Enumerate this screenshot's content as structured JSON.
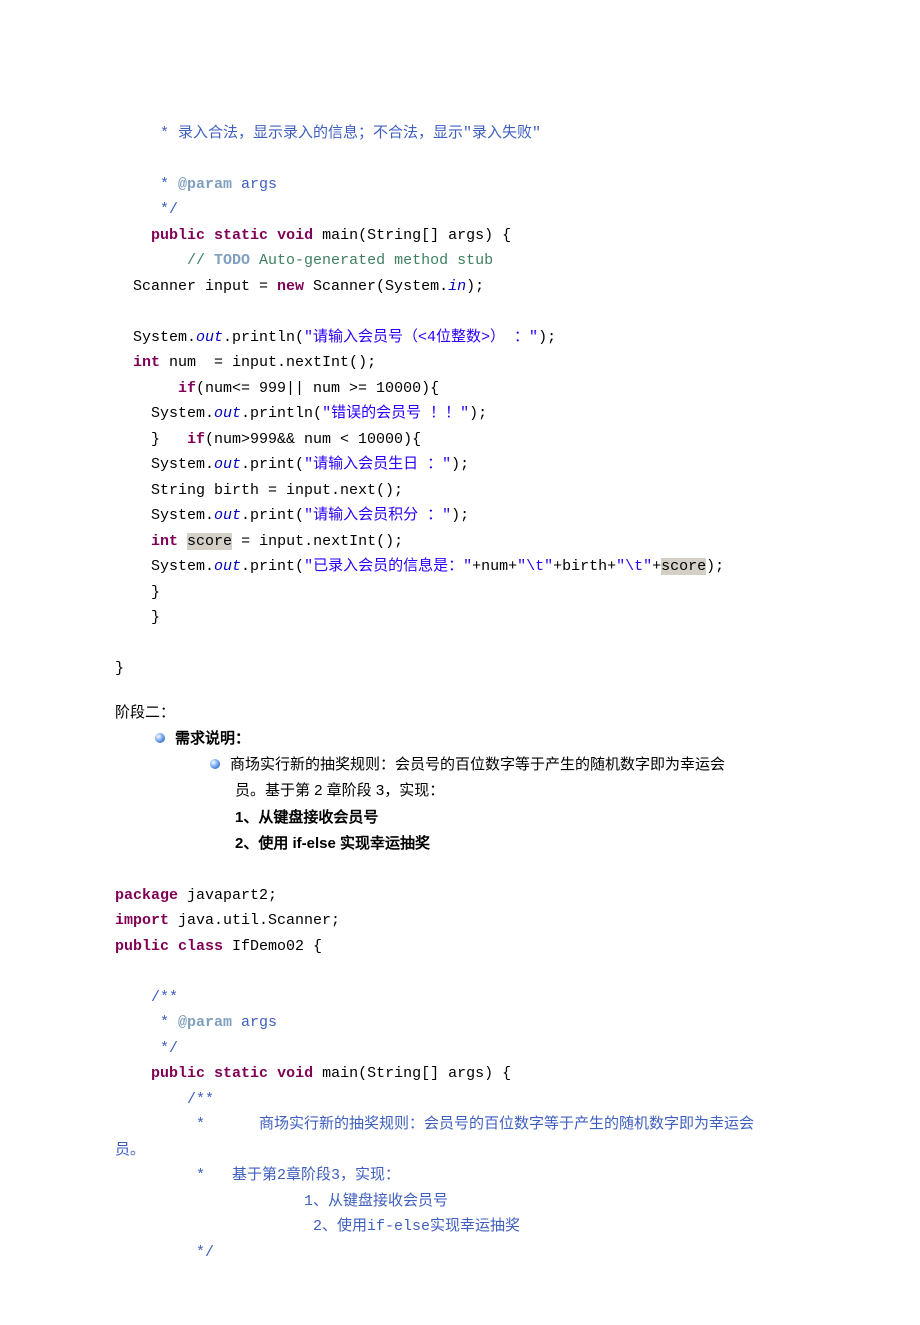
{
  "code1": {
    "c1": "     * 录入合法，显示录入的信息；不合法，显示\"录入失败\"",
    "c2": "     * ",
    "c2_tag": "@param",
    "c2_arg": " args",
    "c3": "     */",
    "m1_kw1": "public",
    "m1_kw2": "static",
    "m1_kw3": "void",
    "m1_a": " main(String[] args) {",
    "m2_c1": "// ",
    "m2_todo": "TODO",
    "m2_c2": " Auto-generated method stub",
    "l_scan1": "  Scanner input = ",
    "l_scan_kw": "new",
    "l_scan2": " Scanner(System.",
    "l_scan_in": "in",
    "l_scan3": ");",
    "l_p1_a": "  System.",
    "l_p1_out": "out",
    "l_p1_b": ".println(",
    "l_p1_s": "\"请输入会员号（<4位整数>） ：\"",
    "l_p1_c": ");",
    "l_int_kw": "int",
    "l_int_rest": " num  = input.nextInt();",
    "l_if1_kw": "if",
    "l_if1_rest": "(num<= 999|| num >= 10000){",
    "l_err_a": "    System.",
    "l_err_out": "out",
    "l_err_b": ".println(",
    "l_err_s": "\"错误的会员号 ！！\"",
    "l_err_c": ");",
    "l_close_if1": "    }   ",
    "l_if2_kw": "if",
    "l_if2_rest": "(num>999&& num < 10000){",
    "l_birth_p_a": "    System.",
    "l_birth_p_out": "out",
    "l_birth_p_b": ".print(",
    "l_birth_p_s": "\"请输入会员生日 ：\"",
    "l_birth_p_c": ");",
    "l_birth_v": "    String birth = input.next();",
    "l_score_p_a": "    System.",
    "l_score_p_out": "out",
    "l_score_p_b": ".print(",
    "l_score_p_s": "\"请输入会员积分 ：\"",
    "l_score_p_c": ");",
    "l_score_kw": "int",
    "l_score_v1": " ",
    "l_score_hl": "score",
    "l_score_v2": " = input.nextInt();",
    "l_final_a": "    System.",
    "l_final_out": "out",
    "l_final_b": ".print(",
    "l_final_s1": "\"已录入会员的信息是：\"",
    "l_final_plus": "+num+",
    "l_final_s2": "\"\\t\"",
    "l_final_plus2": "+birth+",
    "l_final_s3": "\"\\t\"",
    "l_final_plus3": "+",
    "l_final_hl": "score",
    "l_final_c": ");",
    "l_close_braces": "    }\n    }\n\n}"
  },
  "doc": {
    "stage_title": "阶段二：",
    "req_label": "需求说明：",
    "desc_line1": "商场实行新的抽奖规则：会员号的百位数字等于产生的随机数字即为幸运会",
    "desc_line2": "员。基于第 2 章阶段 3，实现：",
    "num1": "1、从键盘接收会员号",
    "num2": "2、使用 if-else 实现幸运抽奖"
  },
  "code2": {
    "pkg_kw": "package",
    "pkg_rest": " javapart2;",
    "imp_kw": "import",
    "imp_rest": " java.util.Scanner;",
    "cls_kw1": "public",
    "cls_kw2": "class",
    "cls_rest": " IfDemo02 {",
    "jd_open": "    /**",
    "jd_star": "     * ",
    "jd_tag": "@param",
    "jd_arg": " args",
    "jd_close": "     */",
    "m_kw1": "public",
    "m_kw2": "static",
    "m_kw3": "void",
    "m_sig": " main(String[] args) {",
    "c_open": "        /**",
    "c_l1": "         *      商场实行新的抽奖规则：会员号的百位数字等于产生的随机数字即为幸运会",
    "c_l1_end": "员。",
    "c_l2": "         *   基于第2章阶段3，实现：",
    "c_l3": "                     1、从键盘接收会员号",
    "c_l4": "                      2、使用if-else实现幸运抽奖",
    "c_close": "         */"
  }
}
